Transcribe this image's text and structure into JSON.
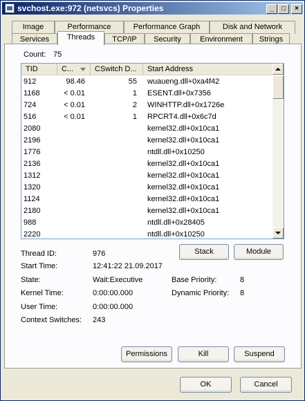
{
  "window": {
    "title": "svchost.exe:972 (netsvcs) Properties",
    "buttons": [
      "_",
      "□",
      "×"
    ]
  },
  "tabs_row1": [
    "Image",
    "Performance",
    "Performance Graph",
    "Disk and Network"
  ],
  "tabs_row2": [
    "Services",
    "Threads",
    "TCP/IP",
    "Security",
    "Environment",
    "Strings"
  ],
  "active_tab": "Threads",
  "count": {
    "label": "Count:",
    "value": "75"
  },
  "columns": [
    "TID",
    "C...",
    "CSwitch D...",
    "Start Address"
  ],
  "rows": [
    [
      "912",
      "98.46",
      "55",
      "wuaueng.dll+0xa4f42"
    ],
    [
      "1168",
      "< 0.01",
      "1",
      "ESENT.dll+0x7356"
    ],
    [
      "724",
      "< 0.01",
      "2",
      "WINHTTP.dll+0x1726e"
    ],
    [
      "516",
      "< 0.01",
      "1",
      "RPCRT4.dll+0x6c7d"
    ],
    [
      "2080",
      "",
      "",
      "kernel32.dll+0x10ca1"
    ],
    [
      "2196",
      "",
      "",
      "kernel32.dll+0x10ca1"
    ],
    [
      "1776",
      "",
      "",
      "ntdll.dll+0x10250"
    ],
    [
      "2136",
      "",
      "",
      "kernel32.dll+0x10ca1"
    ],
    [
      "1312",
      "",
      "",
      "kernel32.dll+0x10ca1"
    ],
    [
      "1320",
      "",
      "",
      "kernel32.dll+0x10ca1"
    ],
    [
      "1124",
      "",
      "",
      "kernel32.dll+0x10ca1"
    ],
    [
      "2180",
      "",
      "",
      "kernel32.dll+0x10ca1"
    ],
    [
      "988",
      "",
      "",
      "ntdll.dll+0x28405"
    ],
    [
      "2220",
      "",
      "",
      "ntdll.dll+0x10250"
    ]
  ],
  "details": {
    "thread_id_label": "Thread ID:",
    "thread_id": "976",
    "start_time_label": "Start Time:",
    "start_time": "12:41:22  21.09.2017",
    "state_label": "State:",
    "state": "Wait:Executive",
    "base_priority_label": "Base Priority:",
    "base_priority": "8",
    "kernel_time_label": "Kernel Time:",
    "kernel_time": "0:00:00.000",
    "dynamic_priority_label": "Dynamic Priority:",
    "dynamic_priority": "8",
    "user_time_label": "User Time:",
    "user_time": "0:00:00.000",
    "context_switches_label": "Context Switches:",
    "context_switches": "243"
  },
  "buttons": {
    "stack": "Stack",
    "module": "Module",
    "permissions": "Permissions",
    "kill": "Kill",
    "suspend": "Suspend",
    "ok": "OK",
    "cancel": "Cancel"
  }
}
